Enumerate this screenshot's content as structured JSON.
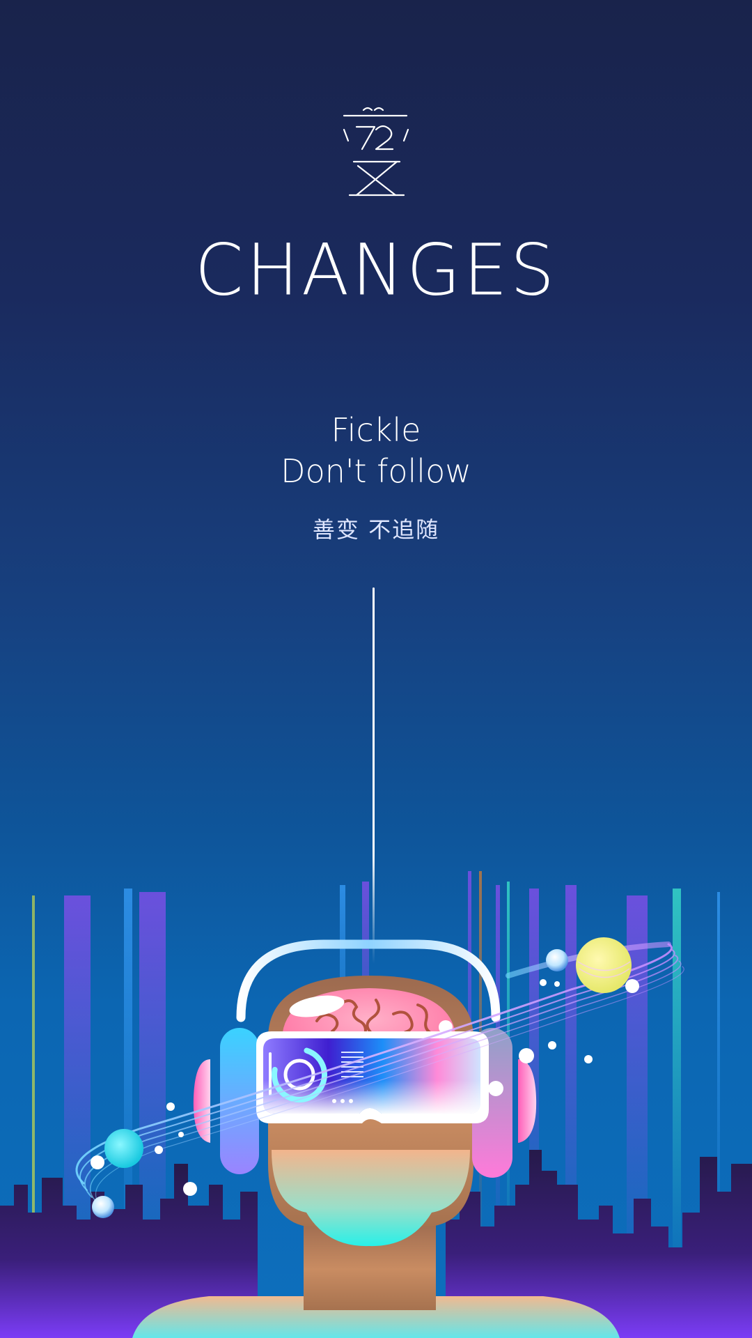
{
  "poster": {
    "logo_mark": "72变",
    "title": "CHANGES",
    "tagline_en_line1": "Fickle",
    "tagline_en_line2": "Don't follow",
    "tagline_cn": "善变 不追随"
  },
  "colors": {
    "background_top": "#19234b",
    "background_bottom": "#0d6fbd",
    "accent_pink": "#ff7ad9",
    "accent_cyan": "#27d3f2",
    "accent_purple": "#7b4dff",
    "text": "#ffffff"
  },
  "illustration": {
    "subject": "vr-headset-head-icon",
    "elements": [
      "brain-icon",
      "vr-goggles-icon",
      "headphones-icon",
      "planet-icon",
      "orbit-ring-icon",
      "city-skyline-icon",
      "light-beam-icon"
    ]
  }
}
